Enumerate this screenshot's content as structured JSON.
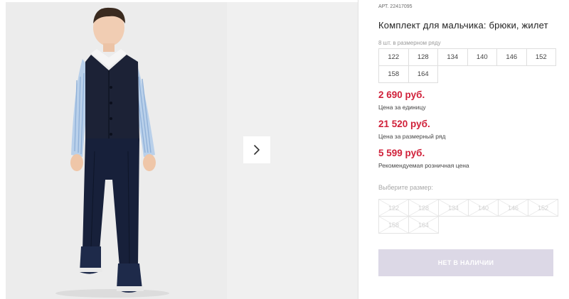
{
  "product": {
    "article_label": "АРТ.",
    "article_number": "22417095",
    "title": "Комплект для мальчика: брюки, жилет",
    "pack_note": "8 шт. в размерном ряду",
    "sizes": [
      "122",
      "128",
      "134",
      "140",
      "146",
      "152",
      "158",
      "164"
    ]
  },
  "prices": {
    "unit_price": "2 690 руб.",
    "unit_label": "Цена за единицу",
    "pack_price": "21 520 руб.",
    "pack_label": "Цена за размерный ряд",
    "retail_price": "5 599 руб.",
    "retail_label": "Рекомендуемая розничная цена"
  },
  "size_select": {
    "label": "Выберите размер:",
    "options": [
      "122",
      "128",
      "134",
      "140",
      "146",
      "152",
      "158",
      "164"
    ],
    "available": false
  },
  "cart_button": {
    "label": "НЕТ В НАЛИЧИИ",
    "enabled": false
  },
  "gallery": {
    "next_icon": "chevron-right-icon"
  },
  "colors": {
    "price": "#d0213a",
    "button_disabled": "#dcd8e6",
    "gallery_bg": "#f0f0f0",
    "vest": "#1c2236",
    "shirt": "#a9c4e2",
    "pants": "#17203a"
  }
}
